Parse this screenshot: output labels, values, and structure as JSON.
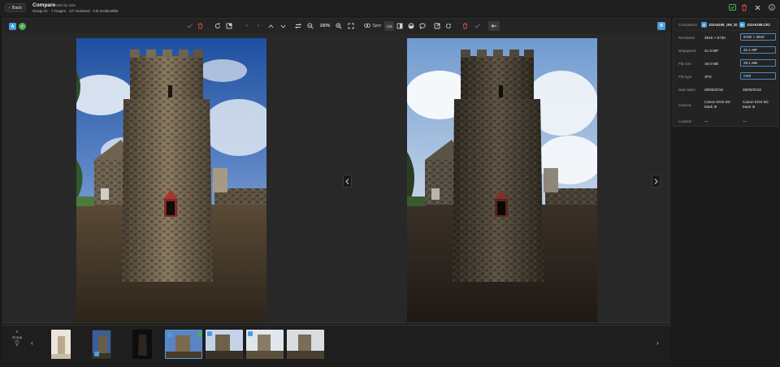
{
  "titlebar": {
    "back_label": "Back",
    "title": "Compare",
    "mode": "Side-by-side",
    "meta": "Group 21 · 7 images · 1/7 reviewed · 0 B reclaimable"
  },
  "toolbar": {
    "zoom_level": "100%",
    "sync_label": "Sync",
    "ab_label": "A|B"
  },
  "badges": {
    "a": "A",
    "b": "B"
  },
  "filmstrip": {
    "group_label": "Group",
    "group_count": "(7)"
  },
  "panel": {
    "comparison_label": "Comparison",
    "a_badge": "A",
    "b_badge": "B",
    "a_file": "102A5198_199_20",
    "b_file": "102A5198.CR2",
    "rows": [
      {
        "label": "Resolution",
        "a": "3819 × 5730",
        "b": "5760 × 3840"
      },
      {
        "label": "Megapixels",
        "a": "21.9 MP",
        "b": "22.1 MP"
      },
      {
        "label": "File size",
        "a": "18.0 MB",
        "b": "29.1 MB"
      },
      {
        "label": "File type",
        "a": "JPG",
        "b": "CR2"
      },
      {
        "label": "Date taken",
        "a": "28/06/2016",
        "b": "28/06/2016"
      },
      {
        "label": "Camera",
        "a": "Canon EOS 5D Mark III",
        "b": "Canon EOS 5D Mark III"
      },
      {
        "label": "Location",
        "a": "—",
        "b": "—"
      }
    ]
  },
  "colors": {
    "accent": "#4a9eda",
    "green": "#4caf50",
    "red": "#d9534f"
  }
}
